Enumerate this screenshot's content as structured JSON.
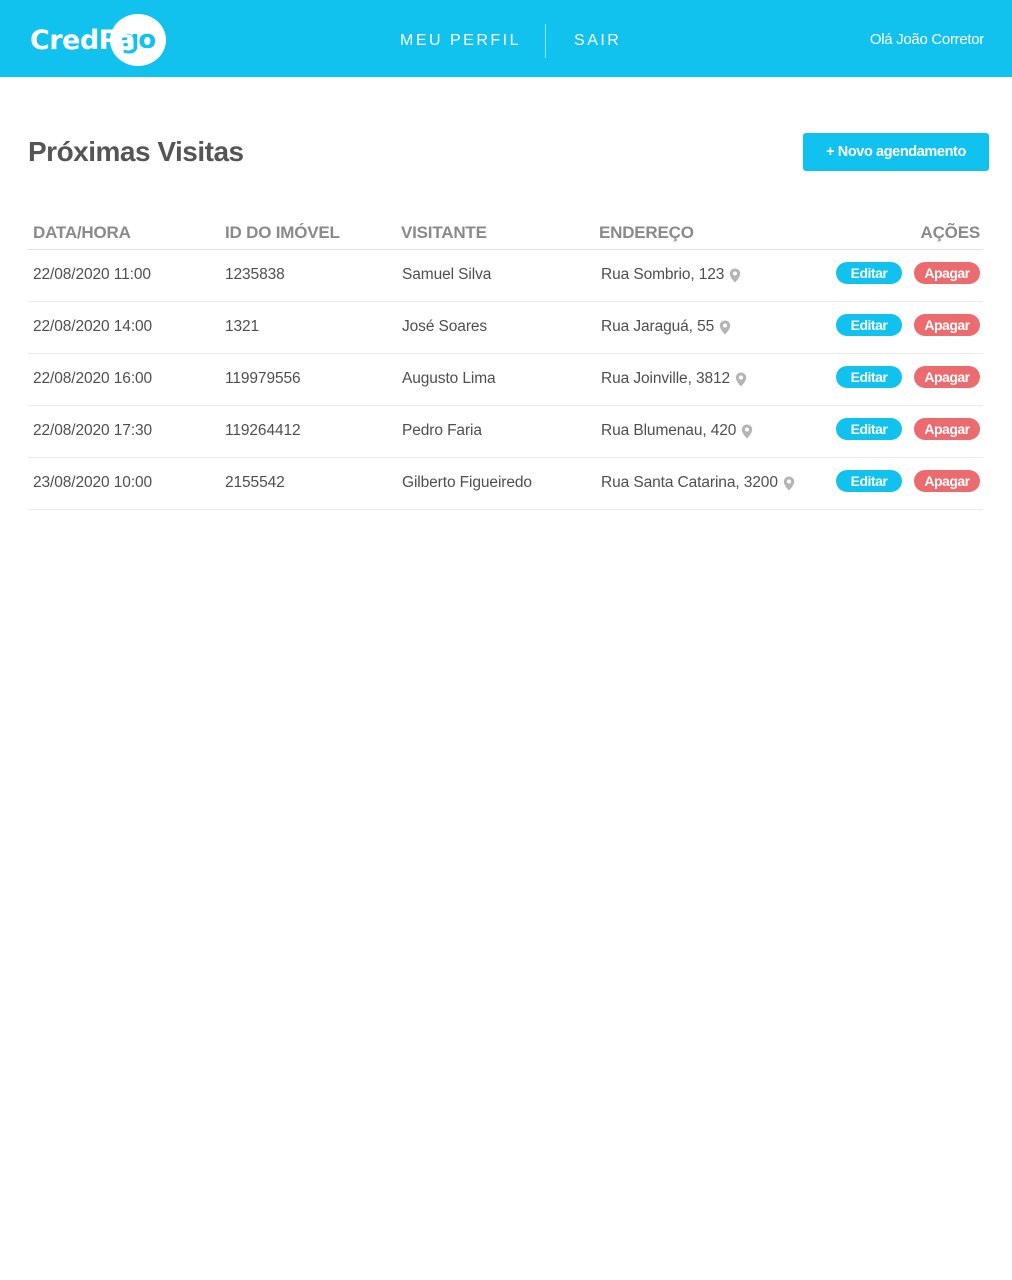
{
  "header": {
    "logo_text": "CredPa",
    "logo_go": "go",
    "nav": [
      {
        "label": "MEU PERFIL"
      },
      {
        "label": "SAIR"
      }
    ],
    "greeting": "Olá João Corretor"
  },
  "main": {
    "title": "Próximas Visitas",
    "new_button": "+ Novo agendamento",
    "columns": [
      "DATA/HORA",
      "ID DO IMÓVEL",
      "VISITANTE",
      "ENDEREÇO",
      "AÇÕES"
    ],
    "rows": [
      {
        "datetime": "22/08/2020 11:00",
        "property_id": "1235838",
        "visitor": "Samuel Silva",
        "address": "Rua Sombrio, 123"
      },
      {
        "datetime": "22/08/2020 14:00",
        "property_id": "1321",
        "visitor": "José Soares",
        "address": "Rua Jaraguá, 55"
      },
      {
        "datetime": "22/08/2020 16:00",
        "property_id": "119979556",
        "visitor": "Augusto Lima",
        "address": "Rua Joinville, 3812"
      },
      {
        "datetime": "22/08/2020 17:30",
        "property_id": "119264412",
        "visitor": "Pedro Faria",
        "address": "Rua Blumenau, 420"
      },
      {
        "datetime": "23/08/2020 10:00",
        "property_id": "2155542",
        "visitor": "Gilberto Figueiredo",
        "address": "Rua Santa Catarina, 3200"
      }
    ],
    "edit_label": "Editar",
    "delete_label": "Apagar",
    "address_icon": "map-pin-icon"
  },
  "colors": {
    "brand": "#11c2ee",
    "danger": "#ec6b6e"
  }
}
